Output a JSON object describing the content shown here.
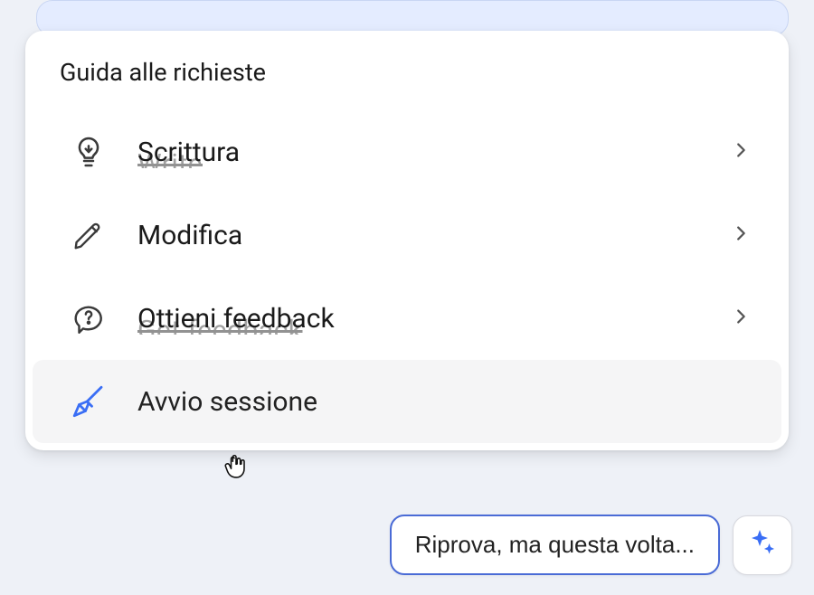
{
  "popover": {
    "title": "Guida alle richieste",
    "items": [
      {
        "icon": "lightbulb",
        "label": "Scrittura",
        "ghost": "Write",
        "chevron": true
      },
      {
        "icon": "pencil",
        "label": "Modifica",
        "ghost": "",
        "chevron": true
      },
      {
        "icon": "chat-q",
        "label": "Ottieni feedback",
        "ghost": "Get feedback",
        "chevron": true
      },
      {
        "icon": "broom",
        "label": "Avvio sessione",
        "ghost": "",
        "chevron": false,
        "hovered": true
      }
    ]
  },
  "bottom": {
    "retry_label": "Riprova, ma questa volta..."
  },
  "colors": {
    "accent": "#4a6bd6",
    "icon_stroke": "#3a3a3a",
    "hover_bg": "#f5f5f6",
    "broom_blue": "#3a6ef5"
  }
}
